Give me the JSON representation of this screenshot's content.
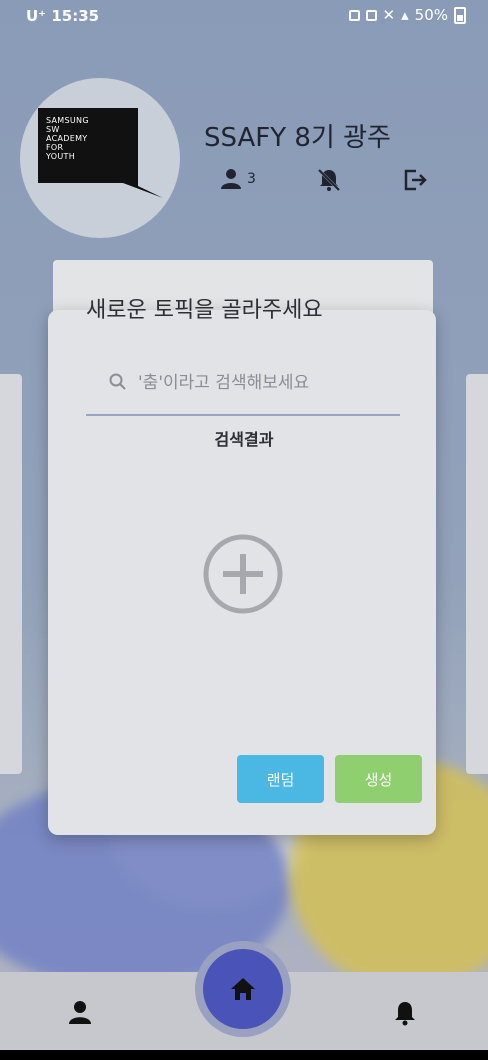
{
  "status_bar": {
    "carrier": "U⁺",
    "time": "15:35",
    "battery": "50%"
  },
  "group": {
    "logo_lines": [
      "SAMSUNG",
      "SW",
      "ACADEMY",
      "FOR",
      "YOUTH"
    ],
    "name": "SSAFY 8기 광주",
    "member_count": "3"
  },
  "modal": {
    "title": "새로운 토픽을 골라주세요",
    "search_placeholder": "'춤'이라고 검색해보세요",
    "results_label": "검색결과",
    "random_label": "랜덤",
    "create_label": "생성"
  },
  "colors": {
    "random_button": "#4bb8e4",
    "create_button": "#8fcf6f",
    "home_button": "#4a54b8"
  },
  "icons": {
    "members": "person-icon",
    "notifications_off": "bell-off-icon",
    "exit": "exit-icon",
    "add": "add-circle-icon",
    "search": "search-icon",
    "nav_profile": "person-icon",
    "nav_home": "home-icon",
    "nav_notifications": "bell-icon"
  }
}
